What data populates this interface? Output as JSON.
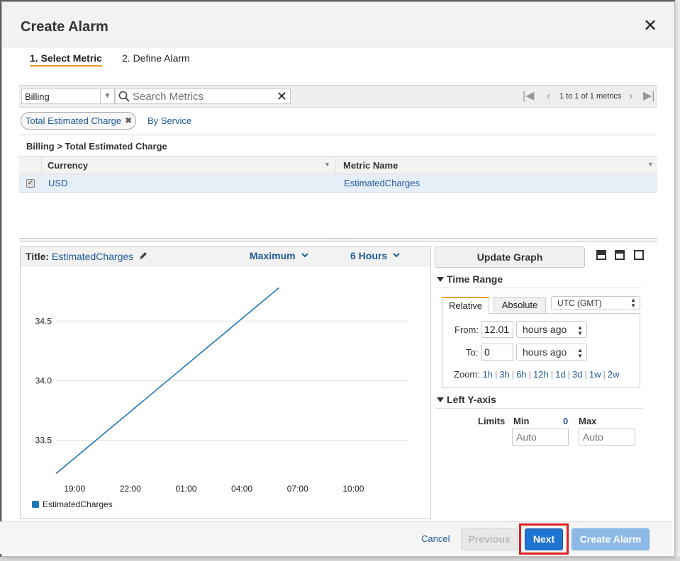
{
  "modal": {
    "title": "Create Alarm",
    "close_glyph": "✕"
  },
  "steps": [
    {
      "label": "1. Select Metric",
      "active": true
    },
    {
      "label": "2. Define Alarm",
      "active": false
    }
  ],
  "filter": {
    "namespace": "Billing",
    "search_placeholder": "Search Metrics",
    "pager_text": "1 to 1 of 1 metrics"
  },
  "tokens": {
    "active": "Total Estimated Charge",
    "link": "By Service"
  },
  "breadcrumb": "Billing > Total Estimated Charge",
  "table": {
    "columns": [
      "Currency",
      "Metric Name"
    ],
    "rows": [
      {
        "checked": true,
        "currency": "USD",
        "metric": "EstimatedCharges"
      }
    ]
  },
  "graph": {
    "title_label": "Title:",
    "title_value": "EstimatedCharges",
    "statistic": "Maximum",
    "period": "6 Hours",
    "legend": "EstimatedCharges"
  },
  "chart_data": {
    "type": "line",
    "x_ticks": [
      "19:00",
      "22:00",
      "01:00",
      "04:00",
      "07:00",
      "10:00"
    ],
    "y_ticks": [
      34.5,
      34.0,
      33.5
    ],
    "ylim": [
      33.2,
      34.9
    ],
    "series": [
      {
        "name": "EstimatedCharges",
        "color": "#1f77b4",
        "points": [
          {
            "t": "18:00",
            "y": 33.22
          },
          {
            "t": "06:00",
            "y": 34.78
          }
        ]
      }
    ],
    "x_hours_span": [
      "18:00",
      "13:00"
    ],
    "grid": true,
    "legend_placement": "bottom-left"
  },
  "side": {
    "update_button": "Update Graph",
    "time_range_header": "Time Range",
    "tabs": [
      "Relative",
      "Absolute"
    ],
    "timezone": "UTC (GMT)",
    "from_label": "From:",
    "from_value": "12.01",
    "from_unit": "hours ago",
    "to_label": "To:",
    "to_value": "0",
    "to_unit": "hours ago",
    "zoom_label": "Zoom:",
    "zoom_options": [
      "1h",
      "3h",
      "6h",
      "12h",
      "1d",
      "3d",
      "1w",
      "2w"
    ],
    "left_y_header": "Left Y-axis",
    "limits_label": "Limits",
    "min_label": "Min",
    "min_value_text": "0",
    "max_label": "Max",
    "min_placeholder": "Auto",
    "max_placeholder": "Auto"
  },
  "footer": {
    "cancel": "Cancel",
    "previous": "Previous",
    "next": "Next",
    "create": "Create Alarm"
  },
  "colors": {
    "accent": "#e89b2e",
    "link": "#1f5a9a",
    "primary": "#1f74d1",
    "highlight": "#e02020"
  }
}
